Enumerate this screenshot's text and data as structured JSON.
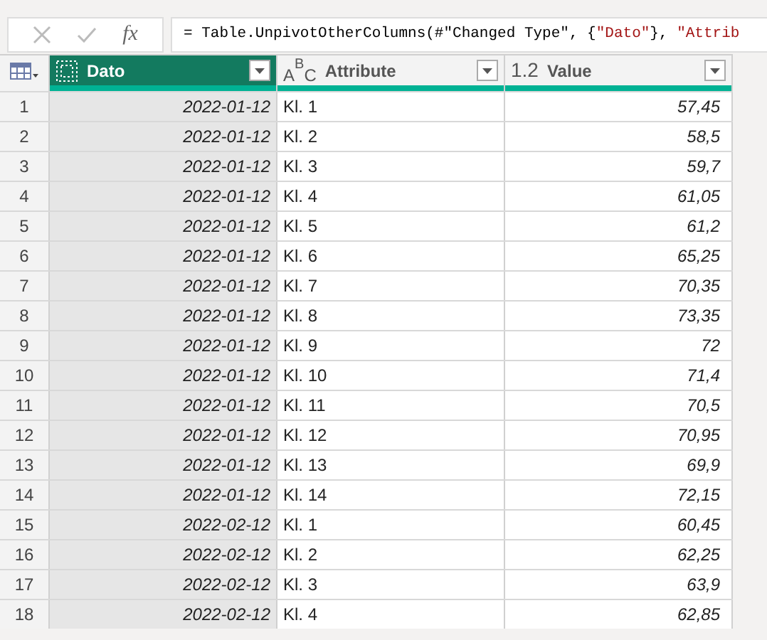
{
  "formula_bar": {
    "fx": "fx",
    "formula": [
      {
        "kind": "plain",
        "text": "= Table.UnpivotOtherColumns(#\"Changed Type\", {"
      },
      {
        "kind": "string",
        "text": "\"Dato\""
      },
      {
        "kind": "plain",
        "text": "}, "
      },
      {
        "kind": "string",
        "text": "\"Attrib"
      }
    ]
  },
  "table": {
    "columns": [
      {
        "name": "Dato",
        "kind": "date",
        "selected": true
      },
      {
        "name": "Attribute",
        "kind": "text",
        "type_label": "ABC",
        "selected": false
      },
      {
        "name": "Value",
        "kind": "number",
        "type_label": "1.2",
        "selected": false
      }
    ],
    "rows": [
      {
        "num": "1",
        "dato": "2022-01-12",
        "attribute": "Kl. 1",
        "value": "57,45"
      },
      {
        "num": "2",
        "dato": "2022-01-12",
        "attribute": "Kl. 2",
        "value": "58,5"
      },
      {
        "num": "3",
        "dato": "2022-01-12",
        "attribute": "Kl. 3",
        "value": "59,7"
      },
      {
        "num": "4",
        "dato": "2022-01-12",
        "attribute": "Kl. 4",
        "value": "61,05"
      },
      {
        "num": "5",
        "dato": "2022-01-12",
        "attribute": "Kl. 5",
        "value": "61,2"
      },
      {
        "num": "6",
        "dato": "2022-01-12",
        "attribute": "Kl. 6",
        "value": "65,25"
      },
      {
        "num": "7",
        "dato": "2022-01-12",
        "attribute": "Kl. 7",
        "value": "70,35"
      },
      {
        "num": "8",
        "dato": "2022-01-12",
        "attribute": "Kl. 8",
        "value": "73,35"
      },
      {
        "num": "9",
        "dato": "2022-01-12",
        "attribute": "Kl. 9",
        "value": "72"
      },
      {
        "num": "10",
        "dato": "2022-01-12",
        "attribute": "Kl. 10",
        "value": "71,4"
      },
      {
        "num": "11",
        "dato": "2022-01-12",
        "attribute": "Kl. 11",
        "value": "70,5"
      },
      {
        "num": "12",
        "dato": "2022-01-12",
        "attribute": "Kl. 12",
        "value": "70,95"
      },
      {
        "num": "13",
        "dato": "2022-01-12",
        "attribute": "Kl. 13",
        "value": "69,9"
      },
      {
        "num": "14",
        "dato": "2022-01-12",
        "attribute": "Kl. 14",
        "value": "72,15"
      },
      {
        "num": "15",
        "dato": "2022-02-12",
        "attribute": "Kl. 1",
        "value": "60,45"
      },
      {
        "num": "16",
        "dato": "2022-02-12",
        "attribute": "Kl. 2",
        "value": "62,25"
      },
      {
        "num": "17",
        "dato": "2022-02-12",
        "attribute": "Kl. 3",
        "value": "63,9"
      },
      {
        "num": "18",
        "dato": "2022-02-12",
        "attribute": "Kl. 4",
        "value": "62,85"
      }
    ]
  }
}
